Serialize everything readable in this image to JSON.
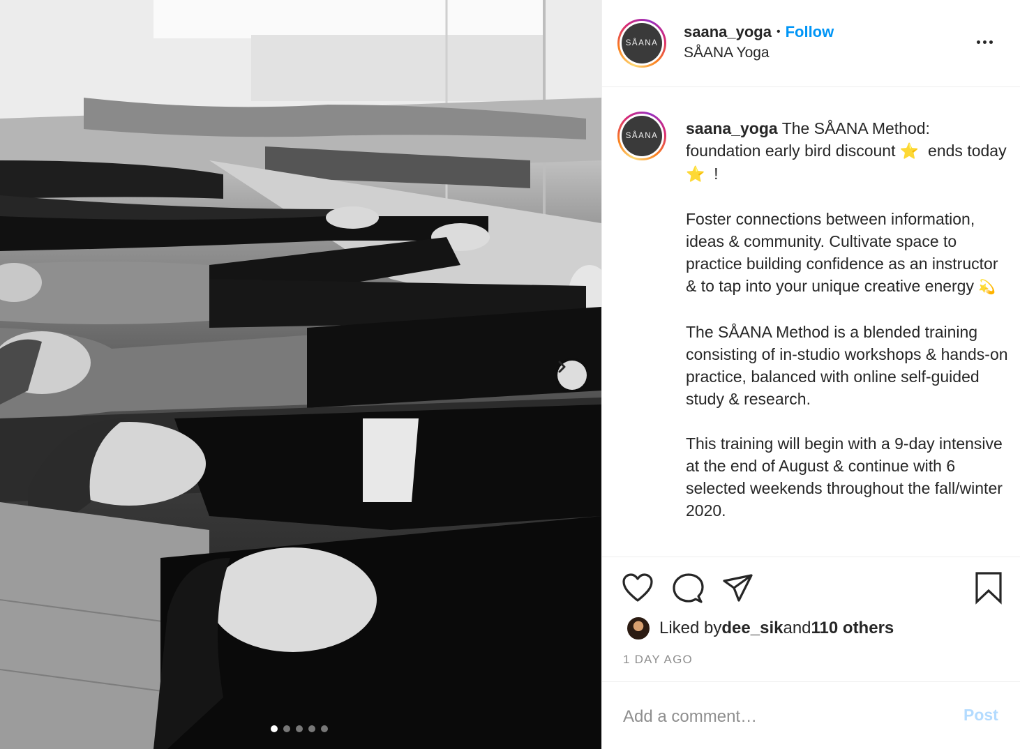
{
  "post": {
    "username": "saana_yoga",
    "separator": "•",
    "follow_label": "Follow",
    "full_name": "SÅANA Yoga",
    "avatar_text": "SÅANA",
    "more_icon": "more-options-icon"
  },
  "media": {
    "description_icon": "photo",
    "next_icon": "chevron-right-icon",
    "carousel_count": 5,
    "carousel_active_index": 0
  },
  "caption": {
    "username": "saana_yoga",
    "text_part1": "The SÅANA Method: foundation early bird discount ",
    "star": "⭐",
    "text_part2": "  ends today ",
    "text_part3": "  !\n\nFoster connections between information, ideas & community. Cultivate space to practice building confidence as an instructor & to tap into your unique creative energy ",
    "dizzy": "💫",
    "text_part4": "\n\nThe SÅANA Method is a blended training consisting of in-studio workshops & hands-on practice, balanced with online self-guided study & research.\n\nThis training will begin with a 9-day intensive at the end of August & continue with 6 selected weekends throughout the fall/winter 2020."
  },
  "actions": {
    "like_icon": "heart-icon",
    "comment_icon": "comment-icon",
    "share_icon": "share-icon",
    "save_icon": "bookmark-icon"
  },
  "likes": {
    "prefix": "Liked by ",
    "user": "dee_sik",
    "middle": " and ",
    "others": "110 others"
  },
  "timestamp": "1 DAY AGO",
  "comment": {
    "placeholder": "Add a comment…",
    "post_label": "Post"
  },
  "colors": {
    "accent": "#0095f6",
    "post_disabled": "#b3dbff",
    "muted": "#8e8e8e"
  }
}
